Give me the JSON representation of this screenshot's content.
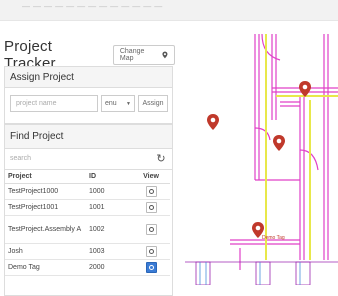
{
  "header": {
    "title": "Project Tracker",
    "change_map_label": "Change Map"
  },
  "assign": {
    "heading": "Assign Project",
    "project_name_placeholder": "project name",
    "select_value": "enu",
    "button_label": "Assign"
  },
  "find": {
    "heading": "Find Project",
    "search_placeholder": "search",
    "columns": {
      "project": "Project",
      "id": "ID",
      "view": "View"
    },
    "rows": [
      {
        "project": "TestProject1000",
        "id": "1000"
      },
      {
        "project": "TestProject1001",
        "id": "1001"
      },
      {
        "project": "TestProject.Assembly A",
        "id": "1002"
      },
      {
        "project": "Josh",
        "id": "1003"
      },
      {
        "project": "Demo Tag",
        "id": "2000"
      }
    ]
  },
  "map": {
    "tag_label": "Demo Tag"
  },
  "colors": {
    "marker": "#c0392b",
    "blueprint_pink": "#e040c8",
    "blueprint_yellow": "#e8e84a",
    "view_active": "#3a7bd5"
  }
}
